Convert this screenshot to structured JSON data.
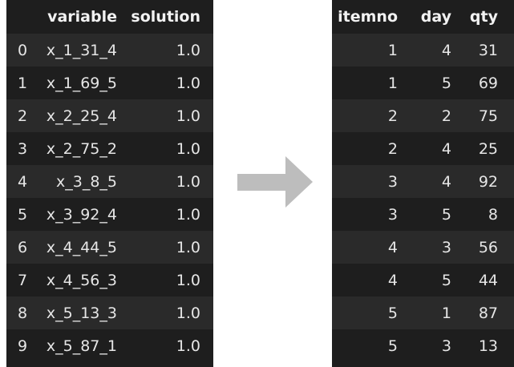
{
  "left_table": {
    "headers": [
      "",
      "variable",
      "solution"
    ],
    "rows": [
      [
        "0",
        "x_1_31_4",
        "1.0"
      ],
      [
        "1",
        "x_1_69_5",
        "1.0"
      ],
      [
        "2",
        "x_2_25_4",
        "1.0"
      ],
      [
        "3",
        "x_2_75_2",
        "1.0"
      ],
      [
        "4",
        "x_3_8_5",
        "1.0"
      ],
      [
        "5",
        "x_3_92_4",
        "1.0"
      ],
      [
        "6",
        "x_4_44_5",
        "1.0"
      ],
      [
        "7",
        "x_4_56_3",
        "1.0"
      ],
      [
        "8",
        "x_5_13_3",
        "1.0"
      ],
      [
        "9",
        "x_5_87_1",
        "1.0"
      ]
    ]
  },
  "arrow": {
    "icon": "right-arrow-icon",
    "color": "#bdbdbd"
  },
  "right_table": {
    "headers": [
      "itemno",
      "day",
      "qty"
    ],
    "rows": [
      [
        "1",
        "4",
        "31"
      ],
      [
        "1",
        "5",
        "69"
      ],
      [
        "2",
        "2",
        "75"
      ],
      [
        "2",
        "4",
        "25"
      ],
      [
        "3",
        "4",
        "92"
      ],
      [
        "3",
        "5",
        "8"
      ],
      [
        "4",
        "3",
        "56"
      ],
      [
        "4",
        "5",
        "44"
      ],
      [
        "5",
        "1",
        "87"
      ],
      [
        "5",
        "3",
        "13"
      ]
    ]
  },
  "colors": {
    "panel_background": "#1e1e1e",
    "row_stripe": "#2a2a2a",
    "text": "#e6e6e6",
    "page_background": "#ffffff"
  }
}
